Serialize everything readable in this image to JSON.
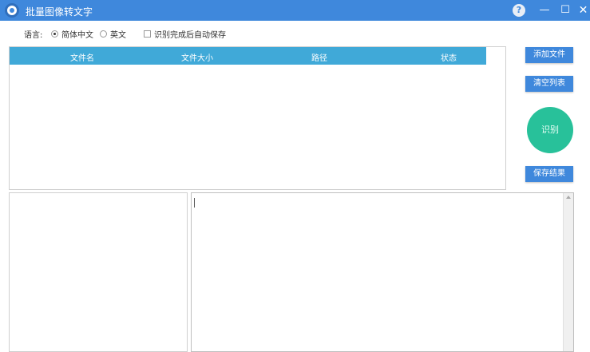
{
  "window": {
    "title": "批量图像转文字",
    "help_label": "?",
    "minimize_label": "—",
    "maximize_label": "☐",
    "close_label": "✕"
  },
  "language": {
    "label": "语言:",
    "options": [
      "简体中文",
      "英文"
    ],
    "selected": "简体中文",
    "auto_save_label": "识别完成后自动保存",
    "auto_save_checked": false
  },
  "file_table": {
    "columns": [
      "文件名",
      "文件大小",
      "路径",
      "状态"
    ],
    "rows": []
  },
  "buttons": {
    "add_file": "添加文件",
    "clear_list": "清空列表",
    "recognize": "识别",
    "save_result": "保存结果"
  },
  "colors": {
    "title_bar": "#3f88dc",
    "table_header": "#40a9d8",
    "recognize_button": "#28c19a"
  }
}
